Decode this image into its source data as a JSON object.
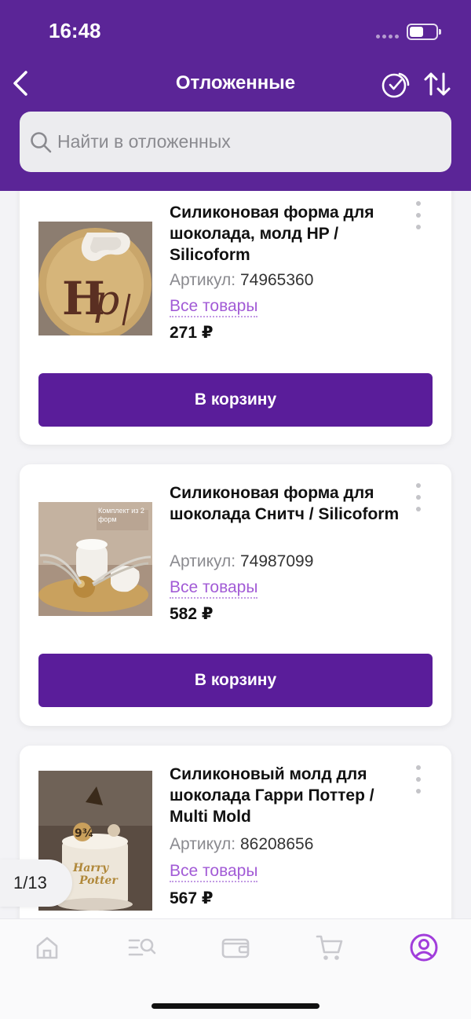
{
  "status_bar": {
    "time": "16:48"
  },
  "header": {
    "title": "Отложенные",
    "search_placeholder": "Найти в отложенных"
  },
  "products": [
    {
      "name": "Силиконовая форма для шоколада, молд HP / Silicoform",
      "article_label": "Артикул:",
      "article": "74965360",
      "all_link": "Все товары",
      "price": "271 ₽",
      "cart_button": "В корзину"
    },
    {
      "name": "Силиконовая форма для шоколада Снитч / Silicoform",
      "article_label": "Артикул:",
      "article": "74987099",
      "all_link": "Все товары",
      "price": "582 ₽",
      "cart_button": "В корзину",
      "image_caption": "Комплект из 2 форм"
    },
    {
      "name": "Силиконовый молд для шоколада Гарри Поттер / Multi Mold",
      "article_label": "Артикул:",
      "article": "86208656",
      "all_link": "Все товары",
      "price": "567 ₽"
    }
  ],
  "page_indicator": "1/13",
  "tabbar": {
    "items": [
      {
        "icon": "home-icon",
        "active": false
      },
      {
        "icon": "catalog-search-icon",
        "active": false
      },
      {
        "icon": "wallet-icon",
        "active": false
      },
      {
        "icon": "cart-icon",
        "active": false
      },
      {
        "icon": "profile-icon",
        "active": true
      }
    ]
  },
  "colors": {
    "brand": "#5b2597",
    "button": "#5a1d9a",
    "link": "#a25bd6",
    "tab_active": "#a13ddb",
    "tab_inactive": "#c9c9ce"
  }
}
